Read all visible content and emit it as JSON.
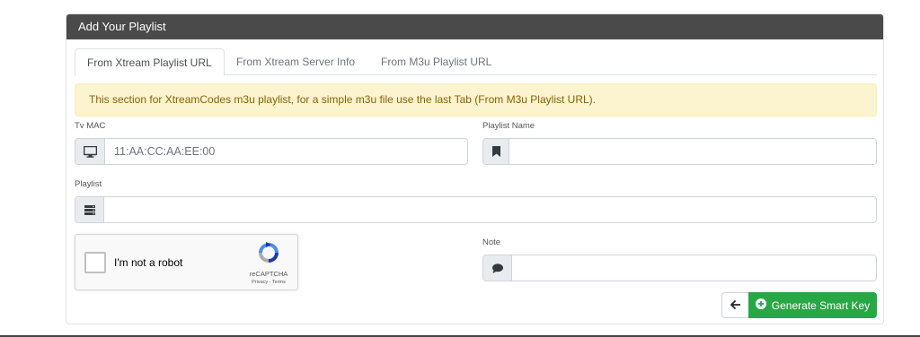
{
  "panel": {
    "title": "Add Your Playlist"
  },
  "tabs": [
    {
      "label": "From Xtream Playlist URL",
      "active": true
    },
    {
      "label": "From Xtream Server Info",
      "active": false
    },
    {
      "label": "From M3u Playlist URL",
      "active": false
    }
  ],
  "alert": {
    "text": "This section for XtreamCodes m3u playlist, for a simple m3u file use the last Tab (From M3u Playlist URL)."
  },
  "form": {
    "tv_mac": {
      "label": "Tv MAC",
      "placeholder": "11:AA:CC:AA:EE:00",
      "icon": "monitor-icon"
    },
    "playlist_name": {
      "label": "Playlist Name",
      "value": "",
      "icon": "bookmark-icon"
    },
    "playlist": {
      "label": "Playlist",
      "value": "",
      "icon": "server-icon"
    },
    "note": {
      "label": "Note",
      "value": "",
      "icon": "comment-icon"
    }
  },
  "captcha": {
    "checkbox_label": "I'm not a robot",
    "brand": "reCAPTCHA",
    "links": "Privacy - Terms"
  },
  "actions": {
    "back_icon": "arrow-left-icon",
    "generate_label": "Generate Smart Key",
    "generate_icon": "plus-circle-icon"
  },
  "colors": {
    "header_bg": "#4a4a4a",
    "alert_bg": "#fcf3cf",
    "alert_text": "#856404",
    "success": "#28a745"
  }
}
